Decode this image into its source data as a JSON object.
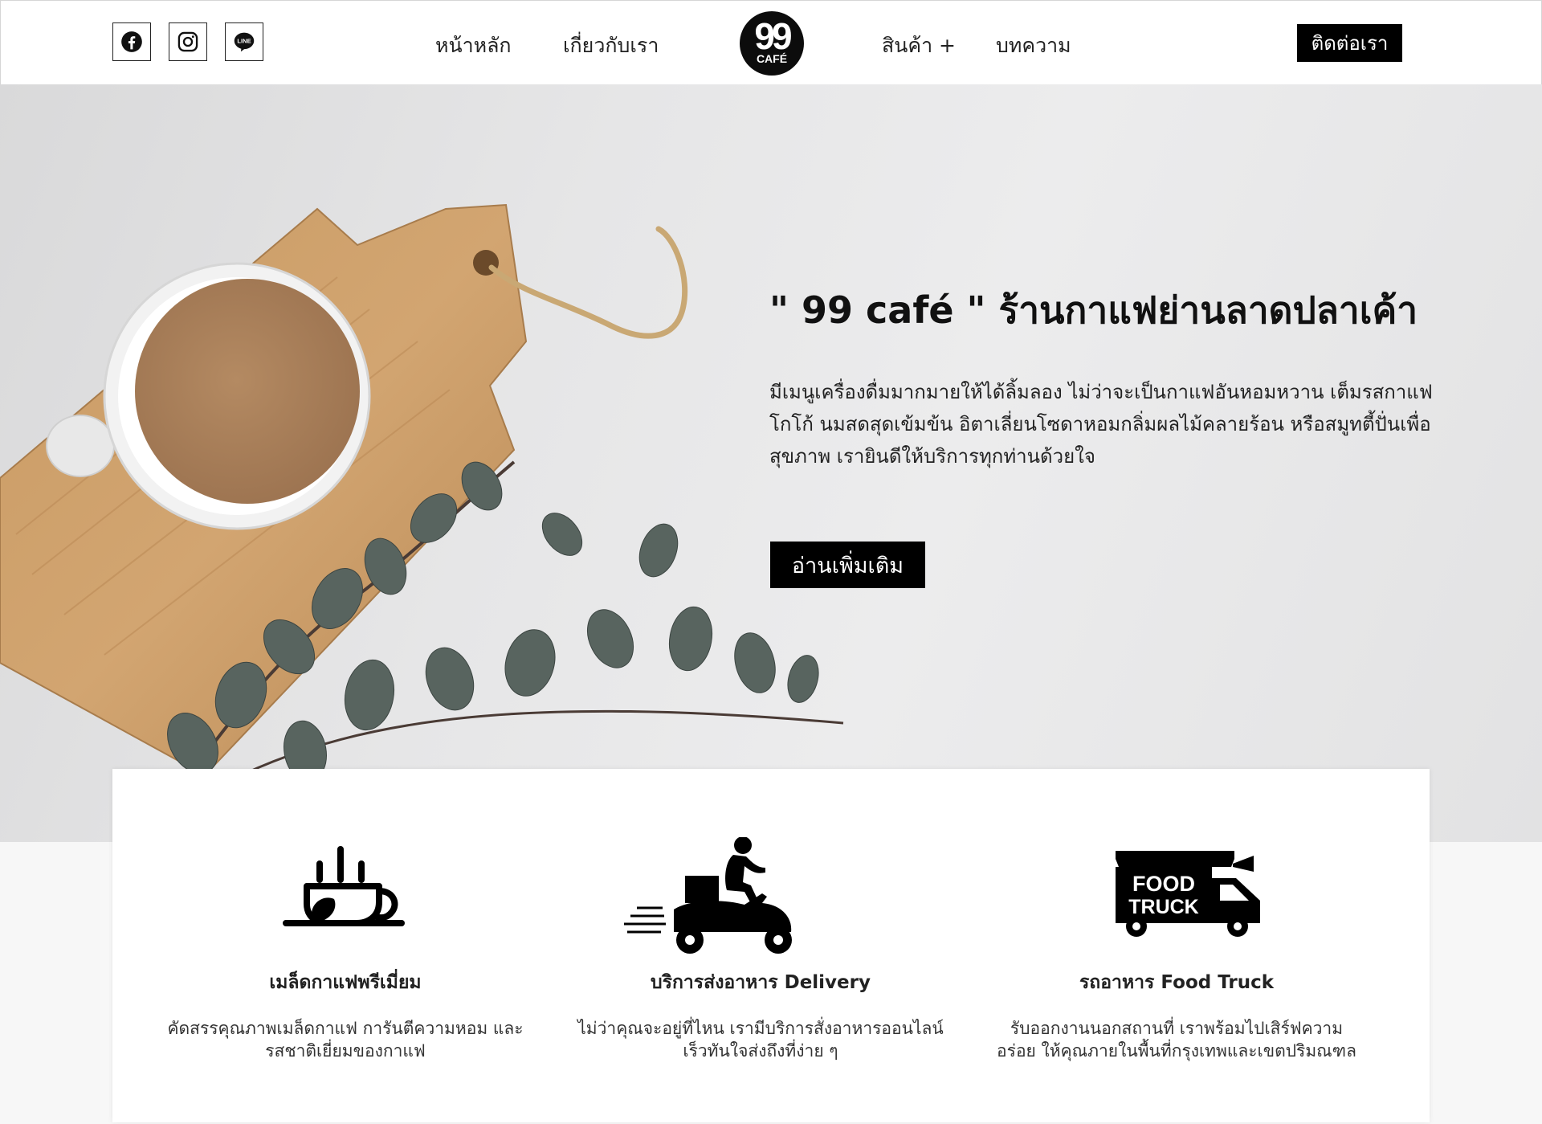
{
  "header": {
    "social": [
      {
        "name": "facebook",
        "icon": "facebook-icon"
      },
      {
        "name": "instagram",
        "icon": "instagram-icon"
      },
      {
        "name": "line",
        "icon": "line-icon",
        "icon_text": "LINE"
      }
    ],
    "nav_left": [
      "หน้าหลัก",
      "เกี่ยวกับเรา"
    ],
    "logo": {
      "number": "99",
      "word": "CAFÉ"
    },
    "nav_right": [
      "สินค้า +",
      "บทความ"
    ],
    "contact_label": "ติดต่อเรา"
  },
  "hero": {
    "title": "\" 99 café \" ร้านกาแฟย่านลาดปลาเค้า",
    "description": "มีเมนูเครื่องดื่มมากมายให้ได้ลิ้มลอง ไม่ว่าจะเป็นกาแฟอันหอมหวาน เต็มรสกาแฟ โกโก้ นมสดสุดเข้มข้น อิตาเลี่ยนโซดาหอมกลิ่มผลไม้คลายร้อน หรือสมูทตี้ปั่นเพื่อสุขภาพ เรายินดีให้บริการทุกท่านด้วยใจ",
    "button_label": "อ่านเพิ่มเติม"
  },
  "features": [
    {
      "icon": "coffee-cup-icon",
      "title": "เมล็ดกาแฟพรีเมี่ยม",
      "text": "คัดสรรคุณภาพเมล็ดกาแฟ การันตีความหอม และรสชาติเยี่ยมของกาแฟ"
    },
    {
      "icon": "delivery-scooter-icon",
      "title": "บริการส่งอาหาร Delivery",
      "text": "ไม่ว่าคุณจะอยู่ที่ไหน เรามีบริการสั่งอาหารออนไลน์ เร็วทันใจส่งถึงที่ง่าย ๆ"
    },
    {
      "icon": "food-truck-icon",
      "title": "รถอาหาร Food Truck",
      "text": "รับออกงานนอกสถานที่ เราพร้อมไปเสิร์ฟความอร่อย ให้คุณภายในพื้นที่กรุงเทพและเขตปริมณฑล",
      "icon_text": [
        "FOOD",
        "TRUCK"
      ]
    }
  ]
}
